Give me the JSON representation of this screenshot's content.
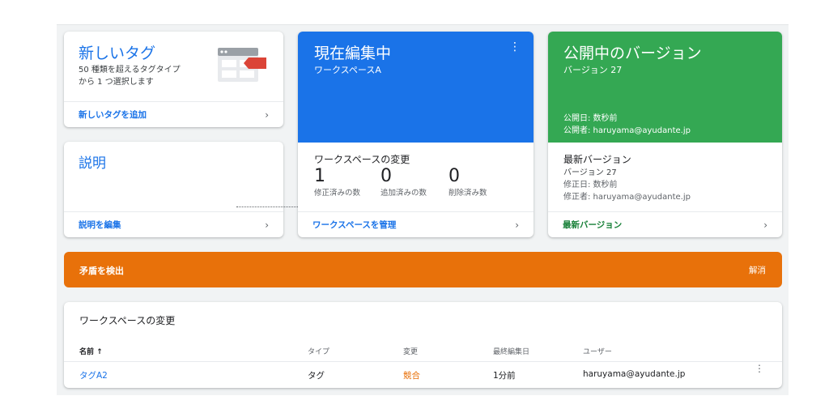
{
  "new_tag": {
    "title": "新しいタグ",
    "desc_line1": "50 種類を超えるタグタイプ",
    "desc_line2": "から 1 つ選択します",
    "footer_label": "新しいタグを追加",
    "footer_chevron": "›"
  },
  "description": {
    "title": "説明",
    "footer_label": "説明を編集",
    "footer_chevron": "›"
  },
  "current_edit": {
    "title": "現在編集中",
    "workspace": "ワークスペースA",
    "changes_heading": "ワークスペースの変更",
    "stats": [
      {
        "value": "1",
        "label": "修正済みの数"
      },
      {
        "value": "0",
        "label": "追加済みの数"
      },
      {
        "value": "0",
        "label": "削除済み数"
      }
    ],
    "footer_label": "ワークスペースを管理",
    "footer_chevron": "›",
    "accent": "#1a73e8"
  },
  "published": {
    "title": "公開中のバージョン",
    "version": "バージョン 27",
    "published_date": "公開日: 数秒前",
    "published_by": "公開者: haruyama@ayudante.jp",
    "latest_heading": "最新バージョン",
    "latest_version": "バージョン 27",
    "modified_date": "修正日: 数秒前",
    "modified_by": "修正者: haruyama@ayudante.jp",
    "footer_label": "最新バージョン",
    "footer_chevron": "›",
    "accent": "#34a853"
  },
  "conflict_banner": {
    "text": "矛盾を検出",
    "action": "解消",
    "color": "#e8710a"
  },
  "changes_table": {
    "title": "ワークスペースの変更",
    "columns": [
      "名前 ↑",
      "タイプ",
      "変更",
      "最終編集日",
      "ユーザー"
    ],
    "rows": [
      {
        "name": "タグA2",
        "type": "タグ",
        "change": "競合",
        "edited": "1分前",
        "user": "haruyama@ayudante.jp"
      }
    ]
  }
}
